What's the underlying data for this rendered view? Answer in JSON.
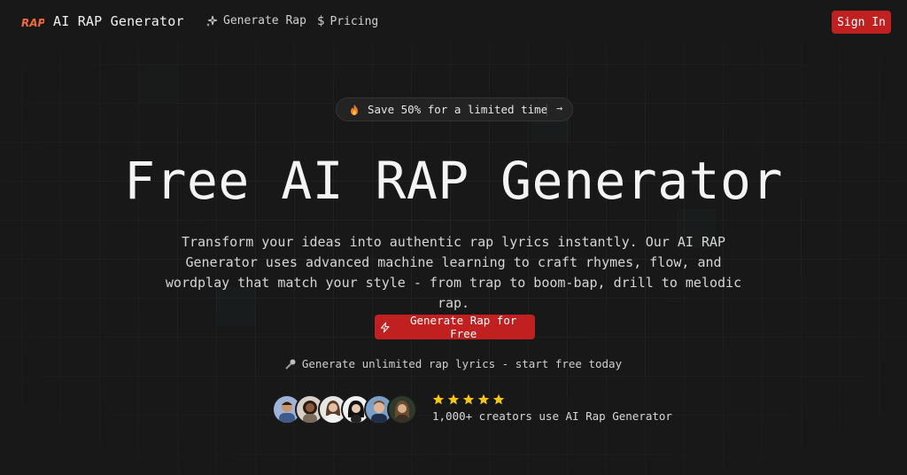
{
  "nav": {
    "logo_text": "RAP",
    "brand": "AI RAP Generator",
    "links": [
      {
        "label": "Generate Rap",
        "icon": "sparkles-icon"
      },
      {
        "label": "Pricing",
        "icon": "dollar-icon"
      }
    ],
    "sign_in": "Sign In"
  },
  "promo": {
    "icon": "fire-icon",
    "text": "Save 50% for a limited time",
    "arrow": "→"
  },
  "hero": {
    "title": "Free AI RAP Generator",
    "description": "Transform your ideas into authentic rap lyrics instantly. Our AI RAP Generator uses advanced machine learning to craft rhymes, flow, and wordplay that match your style - from trap to boom-bap, drill to melodic rap.",
    "cta_label": "Generate Rap for Free",
    "cta_icon": "lightning-icon",
    "tagline": "Generate unlimited rap lyrics - start free today",
    "tagline_icon": "microphone-icon"
  },
  "social_proof": {
    "rating": 5,
    "rating_max": 5,
    "text": "1,000+ creators use AI Rap Generator",
    "avatar_count": 6
  },
  "colors": {
    "accent": "#c0201f",
    "background": "#181818",
    "star": "#f5c518"
  }
}
